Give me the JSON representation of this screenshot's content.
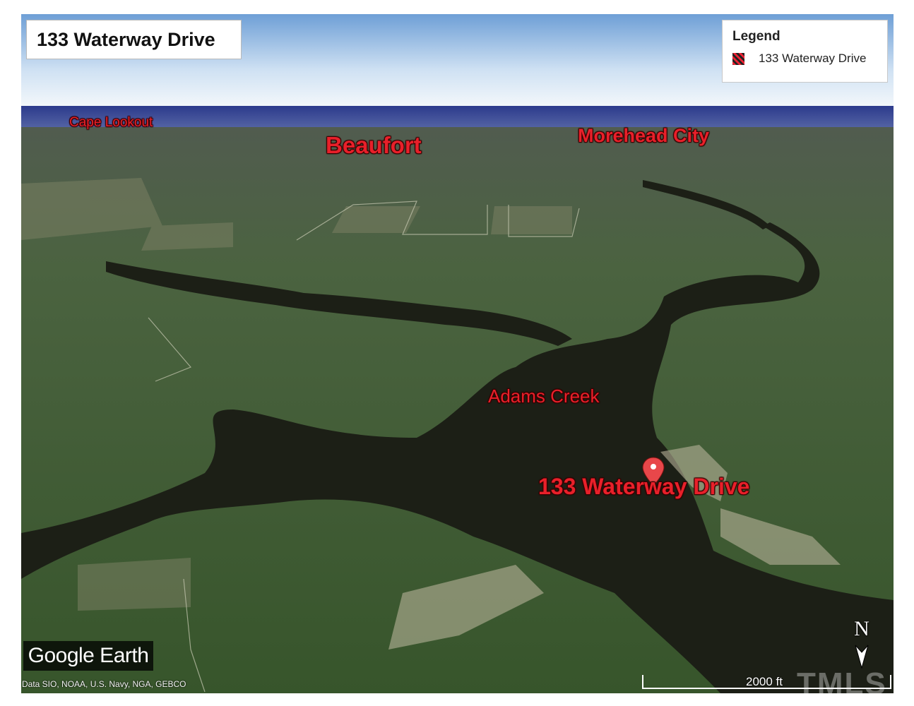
{
  "title": "133 Waterway Drive",
  "legend": {
    "heading": "Legend",
    "items": [
      {
        "label": "133 Waterway Drive",
        "icon": "red-black-checker-swatch"
      }
    ]
  },
  "places": {
    "cape_lookout": "Cape Lookout",
    "beaufort": "Beaufort",
    "morehead_city": "Morehead City",
    "adams_creek": "Adams Creek",
    "property": "133 Waterway Drive"
  },
  "logo": "Google Earth",
  "credits": "Data SIO, NOAA, U.S. Navy, NGA, GEBCO",
  "north_label": "N",
  "scale_label": "2000 ft",
  "watermark": "TMLS",
  "colors": {
    "place_label": "#e8202a",
    "water": "#1c1f16",
    "ocean": "#3b4c9a",
    "land": "#3c5a2c",
    "marker": "#e8474a"
  }
}
